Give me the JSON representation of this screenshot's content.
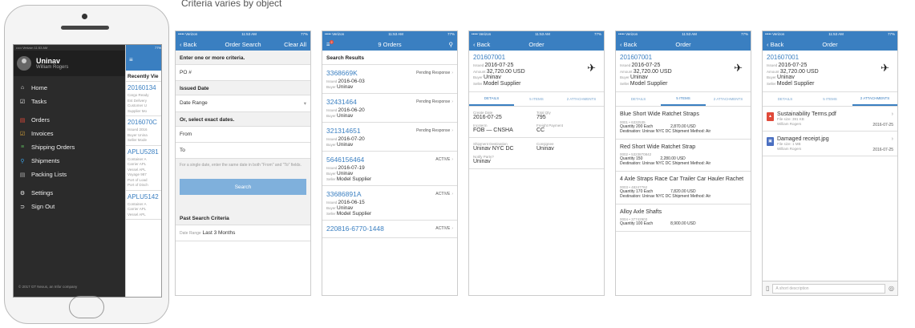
{
  "caption": "Criteria varies by object",
  "status": {
    "carrier": "••••• Verizon",
    "time": "11:53 AM",
    "battery": "77%"
  },
  "menu": {
    "user_name": "Uninav",
    "user_sub": "William Rogers",
    "items": [
      {
        "icon": "⌂",
        "label": "Home"
      },
      {
        "icon": "☑",
        "label": "Tasks"
      },
      {
        "icon": "▤",
        "label": "Orders"
      },
      {
        "icon": "☑",
        "label": "Invoices"
      },
      {
        "icon": "≡",
        "label": "Shipping Orders"
      },
      {
        "icon": "⚲",
        "label": "Shipments"
      },
      {
        "icon": "▤",
        "label": "Packing Lists"
      },
      {
        "icon": "⚙",
        "label": "Settings"
      },
      {
        "icon": "⊃",
        "label": "Sign Out"
      }
    ],
    "footer": "© 2017 GT Nexus, an Infor company",
    "peek_header": "Recently Vie",
    "peek": [
      {
        "num": "20160134",
        "lines": [
          "Cargo Ready",
          "Est Delivery",
          "Customer U",
          "Supplier Mo"
        ]
      },
      {
        "num": "2016070C",
        "lines": [
          "Issued 2016",
          "Buyer Unina",
          "Seller Mode"
        ]
      },
      {
        "num": "APLU5281",
        "lines": [
          "Container A",
          "Carrier APL",
          "Vessel APL",
          "Voyage 987",
          "Port of Load",
          "Port of Disch"
        ]
      },
      {
        "num": "APLU5142",
        "lines": [
          "Container A",
          "Carrier APL",
          "Vessel APL"
        ]
      }
    ]
  },
  "search": {
    "back": "Back",
    "title": "Order Search",
    "clear": "Clear All",
    "s1": "Enter one or more criteria.",
    "po": "PO #",
    "s2": "Issued Date",
    "range": "Date Range",
    "s3": "Or, select exact dates.",
    "from": "From",
    "to": "To",
    "hint": "For a single date, enter the same date in both \"From\" and \"To\" fields.",
    "button": "Search",
    "s4": "Past Search Criteria",
    "past_k": "Date Range",
    "past_v": "Last 3 Months"
  },
  "results": {
    "title": "9 Orders",
    "badge": "2",
    "header": "Search Results",
    "rows": [
      {
        "id": "3368669K",
        "status": "Pending Response",
        "issued": "2016-06-03",
        "buyer": "Uninav",
        "seller": ""
      },
      {
        "id": "32431464",
        "status": "Pending Response",
        "issued": "2016-06-20",
        "buyer": "Uninav",
        "seller": ""
      },
      {
        "id": "321314651",
        "status": "Pending Response",
        "issued": "2016-07-20",
        "buyer": "Uninav",
        "seller": ""
      },
      {
        "id": "5646156464",
        "status": "ACTIVE",
        "issued": "2016-07-19",
        "buyer": "Uninav",
        "seller": "Model Supplier"
      },
      {
        "id": "33686891A",
        "status": "ACTIVE",
        "issued": "2016-06-15",
        "buyer": "Uninav",
        "seller": "Model Supplier"
      },
      {
        "id": "220816-6770-1448",
        "status": "ACTIVE",
        "issued": "",
        "buyer": "",
        "seller": ""
      }
    ]
  },
  "order": {
    "back": "Back",
    "title": "Order",
    "id": "201607001",
    "issued": "2016-07-25",
    "amount": "32,720.00 USD",
    "buyer": "Uninav",
    "seller": "Model Supplier",
    "k_issued": "Issued",
    "k_amount": "Amount",
    "k_buyer": "Buyer",
    "k_seller": "Seller",
    "tabs": [
      "DETAILS",
      "5 ITEMS",
      "2 ATTACHMENTS"
    ],
    "details": [
      {
        "k": "Create Date",
        "v": "2016-07-25"
      },
      {
        "k": "Total Qty",
        "v": "795"
      },
      {
        "k": "Incoterm",
        "v": "FOB — CNSHA"
      },
      {
        "k": "Freight Payment",
        "v": "CC"
      },
      {
        "k": "Shipment Destination",
        "v": "Uninav NYC DC"
      },
      {
        "k": "Consignee",
        "v": "Uninav"
      },
      {
        "k": "Notify Party?",
        "v": "Uninav"
      }
    ],
    "items": [
      {
        "name": "Blue Short Wide Ratchet Straps",
        "sub": "0001 • 6332535",
        "qty": "Quantity 200 Each",
        "price": "2,870.00 USD",
        "dest": "Destination: Uninav NYC DC   Shipment Method: Air"
      },
      {
        "name": "Red Short Wide Ratchet Strap",
        "sub": "0002 • 5323870842",
        "qty": "Quantity 150",
        "price": "2,280.00 USD",
        "dest": "Destination: Uninav NYC DC   Shipment Method: Air"
      },
      {
        "name": "4 Axle Straps Race Car Trailer Car Hauler Rachet",
        "sub": "0003 • 48247762",
        "qty": "Quantity 170 Each",
        "price": "7,820.00 USD",
        "dest": "Destination: Uninav NYC DC   Shipment Method: Air"
      },
      {
        "name": "Alloy Axle Shafts",
        "sub": "0004 • 37742903",
        "qty": "Quantity 100 Each",
        "price": "8,900.00 USD",
        "dest": ""
      }
    ],
    "attachments": [
      {
        "name": "Sustainability Terms.pdf",
        "size": "File size: 391 KB",
        "by": "William Rogers",
        "date": "2016-07-25",
        "color": "#e04a3a",
        "glyph": "▲"
      },
      {
        "name": "Damaged receipt.jpg",
        "size": "File size: 1 MB",
        "by": "William Rogers",
        "date": "2016-07-25",
        "color": "#4a6fc1",
        "glyph": "▣"
      }
    ],
    "desc_placeholder": "A short description"
  }
}
